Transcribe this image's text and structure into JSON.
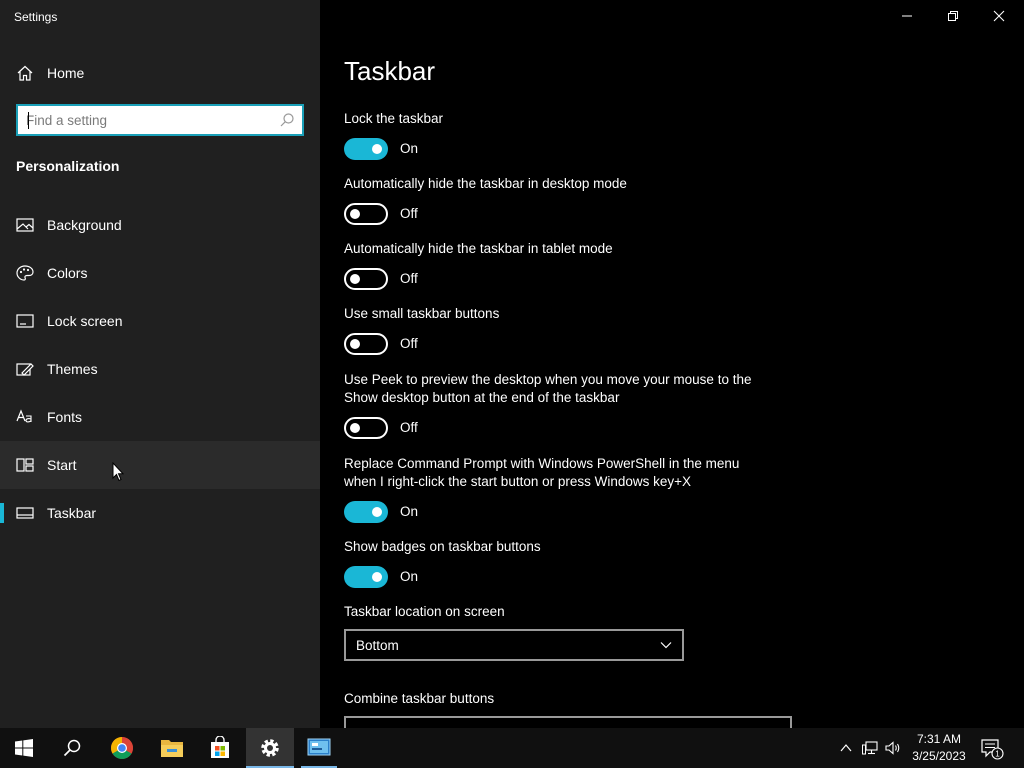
{
  "window": {
    "title": "Settings",
    "controls": {
      "minimize": "minimize-icon",
      "restore": "restore-icon",
      "close": "close-icon"
    }
  },
  "sidebar": {
    "home_label": "Home",
    "search": {
      "placeholder": "Find a setting",
      "value": ""
    },
    "section_title": "Personalization",
    "items": [
      {
        "label": "Background",
        "icon": "image-icon"
      },
      {
        "label": "Colors",
        "icon": "palette-icon"
      },
      {
        "label": "Lock screen",
        "icon": "lock-screen-icon"
      },
      {
        "label": "Themes",
        "icon": "themes-icon"
      },
      {
        "label": "Fonts",
        "icon": "fonts-icon"
      },
      {
        "label": "Start",
        "icon": "start-icon",
        "state": "hover"
      },
      {
        "label": "Taskbar",
        "icon": "taskbar-icon",
        "state": "selected"
      }
    ]
  },
  "main": {
    "title": "Taskbar",
    "settings": [
      {
        "label": "Lock the taskbar",
        "on": true,
        "state_label": "On"
      },
      {
        "label": "Automatically hide the taskbar in desktop mode",
        "on": false,
        "state_label": "Off"
      },
      {
        "label": "Automatically hide the taskbar in tablet mode",
        "on": false,
        "state_label": "Off"
      },
      {
        "label": "Use small taskbar buttons",
        "on": false,
        "state_label": "Off"
      },
      {
        "label": "Use Peek to preview the desktop when you move your mouse to the Show desktop button at the end of the taskbar",
        "on": false,
        "state_label": "Off"
      },
      {
        "label": "Replace Command Prompt with Windows PowerShell in the menu when I right-click the start button or press Windows key+X",
        "on": true,
        "state_label": "On"
      },
      {
        "label": "Show badges on taskbar buttons",
        "on": true,
        "state_label": "On"
      }
    ],
    "location": {
      "label": "Taskbar location on screen",
      "value": "Bottom"
    },
    "combine": {
      "label": "Combine taskbar buttons"
    }
  },
  "taskbar": {
    "apps": [
      "start-icon",
      "search-icon",
      "chrome-icon",
      "file-explorer-icon",
      "store-icon",
      "settings-icon",
      "control-panel-icon"
    ],
    "clock": {
      "time": "7:31 AM",
      "date": "3/25/2023"
    },
    "notification_count": "1"
  },
  "colors": {
    "accent": "#1ab7d6",
    "sidebar_bg": "#202020",
    "main_bg": "#000000"
  }
}
